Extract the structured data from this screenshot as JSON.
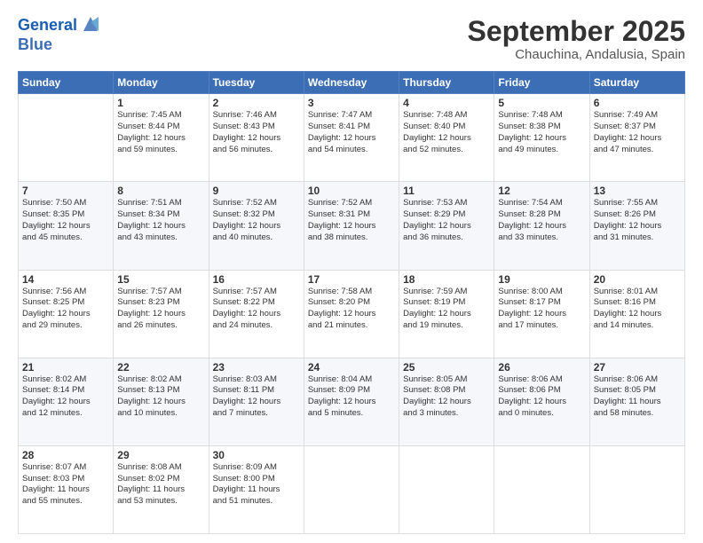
{
  "logo": {
    "text1": "General",
    "text2": "Blue"
  },
  "title": "September 2025",
  "subtitle": "Chauchina, Andalusia, Spain",
  "weekdays": [
    "Sunday",
    "Monday",
    "Tuesday",
    "Wednesday",
    "Thursday",
    "Friday",
    "Saturday"
  ],
  "weeks": [
    [
      {
        "day": "",
        "info": ""
      },
      {
        "day": "1",
        "info": "Sunrise: 7:45 AM\nSunset: 8:44 PM\nDaylight: 12 hours\nand 59 minutes."
      },
      {
        "day": "2",
        "info": "Sunrise: 7:46 AM\nSunset: 8:43 PM\nDaylight: 12 hours\nand 56 minutes."
      },
      {
        "day": "3",
        "info": "Sunrise: 7:47 AM\nSunset: 8:41 PM\nDaylight: 12 hours\nand 54 minutes."
      },
      {
        "day": "4",
        "info": "Sunrise: 7:48 AM\nSunset: 8:40 PM\nDaylight: 12 hours\nand 52 minutes."
      },
      {
        "day": "5",
        "info": "Sunrise: 7:48 AM\nSunset: 8:38 PM\nDaylight: 12 hours\nand 49 minutes."
      },
      {
        "day": "6",
        "info": "Sunrise: 7:49 AM\nSunset: 8:37 PM\nDaylight: 12 hours\nand 47 minutes."
      }
    ],
    [
      {
        "day": "7",
        "info": "Sunrise: 7:50 AM\nSunset: 8:35 PM\nDaylight: 12 hours\nand 45 minutes."
      },
      {
        "day": "8",
        "info": "Sunrise: 7:51 AM\nSunset: 8:34 PM\nDaylight: 12 hours\nand 43 minutes."
      },
      {
        "day": "9",
        "info": "Sunrise: 7:52 AM\nSunset: 8:32 PM\nDaylight: 12 hours\nand 40 minutes."
      },
      {
        "day": "10",
        "info": "Sunrise: 7:52 AM\nSunset: 8:31 PM\nDaylight: 12 hours\nand 38 minutes."
      },
      {
        "day": "11",
        "info": "Sunrise: 7:53 AM\nSunset: 8:29 PM\nDaylight: 12 hours\nand 36 minutes."
      },
      {
        "day": "12",
        "info": "Sunrise: 7:54 AM\nSunset: 8:28 PM\nDaylight: 12 hours\nand 33 minutes."
      },
      {
        "day": "13",
        "info": "Sunrise: 7:55 AM\nSunset: 8:26 PM\nDaylight: 12 hours\nand 31 minutes."
      }
    ],
    [
      {
        "day": "14",
        "info": "Sunrise: 7:56 AM\nSunset: 8:25 PM\nDaylight: 12 hours\nand 29 minutes."
      },
      {
        "day": "15",
        "info": "Sunrise: 7:57 AM\nSunset: 8:23 PM\nDaylight: 12 hours\nand 26 minutes."
      },
      {
        "day": "16",
        "info": "Sunrise: 7:57 AM\nSunset: 8:22 PM\nDaylight: 12 hours\nand 24 minutes."
      },
      {
        "day": "17",
        "info": "Sunrise: 7:58 AM\nSunset: 8:20 PM\nDaylight: 12 hours\nand 21 minutes."
      },
      {
        "day": "18",
        "info": "Sunrise: 7:59 AM\nSunset: 8:19 PM\nDaylight: 12 hours\nand 19 minutes."
      },
      {
        "day": "19",
        "info": "Sunrise: 8:00 AM\nSunset: 8:17 PM\nDaylight: 12 hours\nand 17 minutes."
      },
      {
        "day": "20",
        "info": "Sunrise: 8:01 AM\nSunset: 8:16 PM\nDaylight: 12 hours\nand 14 minutes."
      }
    ],
    [
      {
        "day": "21",
        "info": "Sunrise: 8:02 AM\nSunset: 8:14 PM\nDaylight: 12 hours\nand 12 minutes."
      },
      {
        "day": "22",
        "info": "Sunrise: 8:02 AM\nSunset: 8:13 PM\nDaylight: 12 hours\nand 10 minutes."
      },
      {
        "day": "23",
        "info": "Sunrise: 8:03 AM\nSunset: 8:11 PM\nDaylight: 12 hours\nand 7 minutes."
      },
      {
        "day": "24",
        "info": "Sunrise: 8:04 AM\nSunset: 8:09 PM\nDaylight: 12 hours\nand 5 minutes."
      },
      {
        "day": "25",
        "info": "Sunrise: 8:05 AM\nSunset: 8:08 PM\nDaylight: 12 hours\nand 3 minutes."
      },
      {
        "day": "26",
        "info": "Sunrise: 8:06 AM\nSunset: 8:06 PM\nDaylight: 12 hours\nand 0 minutes."
      },
      {
        "day": "27",
        "info": "Sunrise: 8:06 AM\nSunset: 8:05 PM\nDaylight: 11 hours\nand 58 minutes."
      }
    ],
    [
      {
        "day": "28",
        "info": "Sunrise: 8:07 AM\nSunset: 8:03 PM\nDaylight: 11 hours\nand 55 minutes."
      },
      {
        "day": "29",
        "info": "Sunrise: 8:08 AM\nSunset: 8:02 PM\nDaylight: 11 hours\nand 53 minutes."
      },
      {
        "day": "30",
        "info": "Sunrise: 8:09 AM\nSunset: 8:00 PM\nDaylight: 11 hours\nand 51 minutes."
      },
      {
        "day": "",
        "info": ""
      },
      {
        "day": "",
        "info": ""
      },
      {
        "day": "",
        "info": ""
      },
      {
        "day": "",
        "info": ""
      }
    ]
  ]
}
